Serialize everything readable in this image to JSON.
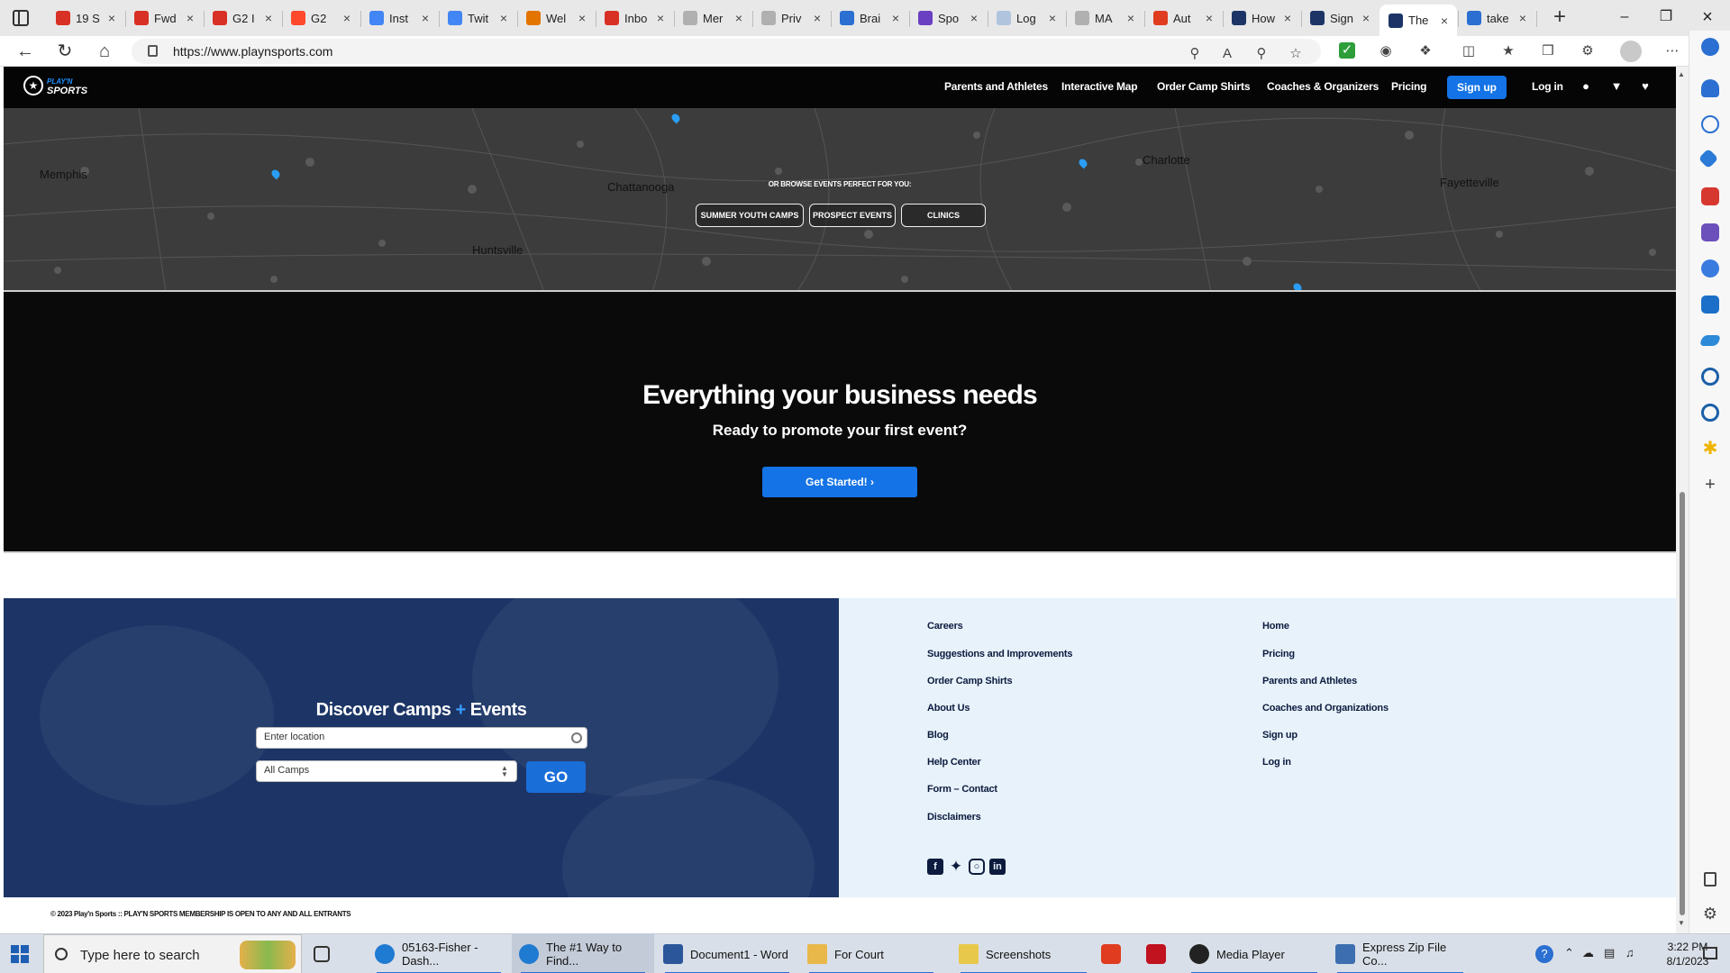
{
  "browser": {
    "tabs": [
      {
        "title": "19 S",
        "favicon": "gmail-icon",
        "color": "#d93025"
      },
      {
        "title": "Fwd",
        "favicon": "gmail-icon",
        "color": "#d93025"
      },
      {
        "title": "G2 I",
        "favicon": "gmail-icon",
        "color": "#d93025"
      },
      {
        "title": "G2",
        "favicon": "g2-icon",
        "color": "#ff492c"
      },
      {
        "title": "Inst",
        "favicon": "google-icon",
        "color": "#4285f4"
      },
      {
        "title": "Twit",
        "favicon": "docs-icon",
        "color": "#4285f4"
      },
      {
        "title": "Wel",
        "favicon": "analytics-icon",
        "color": "#e37400"
      },
      {
        "title": "Inbo",
        "favicon": "gmail-icon",
        "color": "#d93025"
      },
      {
        "title": "Mer",
        "favicon": "generic-icon",
        "color": "#b0b0b0"
      },
      {
        "title": "Priv",
        "favicon": "generic-icon",
        "color": "#b0b0b0"
      },
      {
        "title": "Brai",
        "favicon": "brain-icon",
        "color": "#2a6fd1"
      },
      {
        "title": "Spo",
        "favicon": "video-icon",
        "color": "#6a3fc1"
      },
      {
        "title": "Log",
        "favicon": "image-icon",
        "color": "#b0c4de"
      },
      {
        "title": "MA",
        "favicon": "generic-icon",
        "color": "#b0b0b0"
      },
      {
        "title": "Aut",
        "favicon": "red-circle-icon",
        "color": "#e03c1f"
      },
      {
        "title": "How",
        "favicon": "playnsports-icon",
        "color": "#1c3566"
      },
      {
        "title": "Sign",
        "favicon": "playnsports-icon",
        "color": "#1c3566"
      },
      {
        "title": "The",
        "favicon": "playnsports-icon",
        "color": "#1c3566",
        "active": true
      },
      {
        "title": "take",
        "favicon": "search-icon",
        "color": "#2a6fd1"
      }
    ],
    "url": "https://www.playnsports.com"
  },
  "site": {
    "logo_line1": "PLAY'N",
    "logo_line2": "SPORTS",
    "nav": [
      "Parents and Athletes",
      "Interactive Map",
      "Order Camp Shirts",
      "Coaches & Organizers",
      "Pricing"
    ],
    "signup": "Sign up",
    "login": "Log in",
    "map": {
      "browse_label": "OR BROWSE EVENTS PERFECT FOR YOU:",
      "buttons": [
        "SUMMER YOUTH CAMPS",
        "PROSPECT EVENTS",
        "CLINICS"
      ],
      "cities": [
        "Memphis",
        "Chattanooga",
        "Huntsville",
        "Charlotte",
        "Fayetteville"
      ]
    },
    "business": {
      "title": "Everything your business needs",
      "subtitle": "Ready to promote your first event?",
      "cta": "Get Started! ›"
    },
    "discover": {
      "title_a": "Discover Camps",
      "title_plus": "+",
      "title_b": "Events",
      "location_placeholder": "Enter location",
      "camps_select": "All Camps",
      "go": "GO"
    },
    "footer_links_col1": [
      "Careers",
      "Suggestions and Improvements",
      "Order Camp Shirts",
      "About Us",
      "Blog",
      "Help Center",
      "Form – Contact",
      "Disclaimers"
    ],
    "footer_links_col2": [
      "Home",
      "Pricing",
      "Parents and Athletes",
      "Coaches and Organizations",
      "Sign up",
      "Log in"
    ],
    "social": [
      "facebook-icon",
      "twitter-icon",
      "instagram-icon",
      "linkedin-icon"
    ],
    "copyright": "© 2023 Play'n Sports :: PLAY'N SPORTS MEMBERSHIP IS OPEN TO ANY AND ALL ENTRANTS"
  },
  "taskbar": {
    "search_placeholder": "Type here to search",
    "apps": [
      {
        "label": "05163-Fisher - Dash...",
        "icon": "edge-icon"
      },
      {
        "label": "The #1 Way to Find...",
        "icon": "edge-icon",
        "active": true
      },
      {
        "label": "Document1 - Word",
        "icon": "word-icon"
      },
      {
        "label": "For Court",
        "icon": "folder-icon"
      },
      {
        "label": "Screenshots",
        "icon": "folder-icon"
      },
      {
        "label": "Media Player",
        "icon": "media-player-icon"
      },
      {
        "label": "Express Zip File Co...",
        "icon": "zip-icon"
      }
    ],
    "time": "3:22 PM",
    "date": "8/1/2023"
  }
}
